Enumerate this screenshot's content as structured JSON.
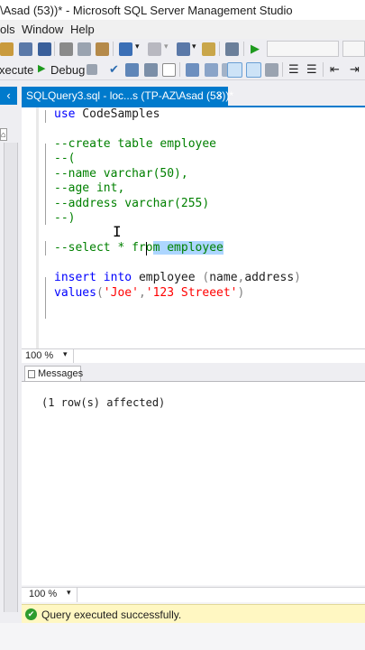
{
  "window": {
    "title": "\\Asad (53))* - Microsoft SQL Server Management Studio"
  },
  "menu": {
    "items": [
      "ols",
      "Window",
      "Help"
    ]
  },
  "toolbar": {
    "execute_label": "xecute",
    "debug_label": "Debug"
  },
  "tab": {
    "label": "SQLQuery3.sql - loc...s (TP-AZ\\Asad (53))*",
    "close": "×"
  },
  "left_panel": {
    "collapse_glyph": "‹",
    "box_glyph": "⌂"
  },
  "editor": {
    "line1_kw": "use",
    "line1_rest": " CodeSamples",
    "line3": "--create table employee",
    "line4": "--(",
    "line5": "--name varchar(50),",
    "line6": "--age int,",
    "line7": "--address varchar(255)",
    "line8": "--)",
    "line10_a": "--select * fro",
    "line10_b": "m employee",
    "line12_kw1": "insert",
    "line12_kw2": "into",
    "line12_table": "employee",
    "line12_col1": "name",
    "line12_col2": "address",
    "line13_kw": "values",
    "line13_s1": "'Joe'",
    "line13_s2": "'123 Streeet'"
  },
  "zoom": {
    "editor_value": "100 %",
    "results_value": "100 %"
  },
  "results": {
    "tab_label": "Messages",
    "message": "(1 row(s) affected)"
  },
  "status": {
    "text": "Query executed successfully."
  },
  "colors": {
    "accent": "#007acc",
    "keyword": "#0000ff",
    "comment": "#008000",
    "string": "#ff0000",
    "status_bg": "#fff7c2"
  }
}
